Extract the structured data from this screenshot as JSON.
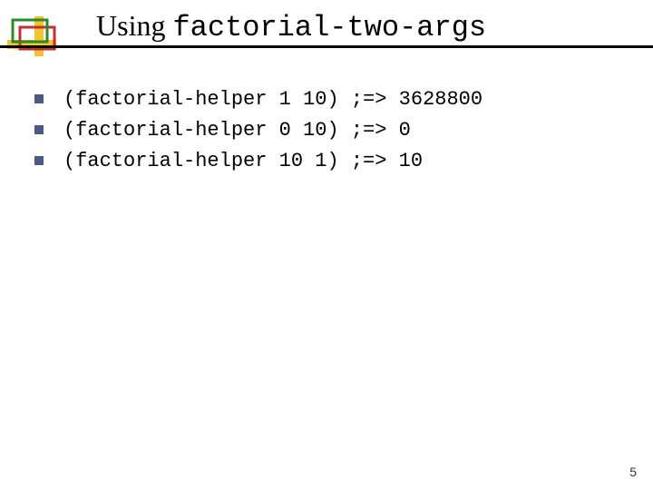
{
  "title": {
    "prefix": "Using ",
    "mono": "factorial-two-args"
  },
  "lines": [
    "(factorial-helper 1 10) ;=> 3628800",
    "(factorial-helper 0 10) ;=> 0",
    "(factorial-helper 10 1) ;=> 10"
  ],
  "page_number": "5"
}
